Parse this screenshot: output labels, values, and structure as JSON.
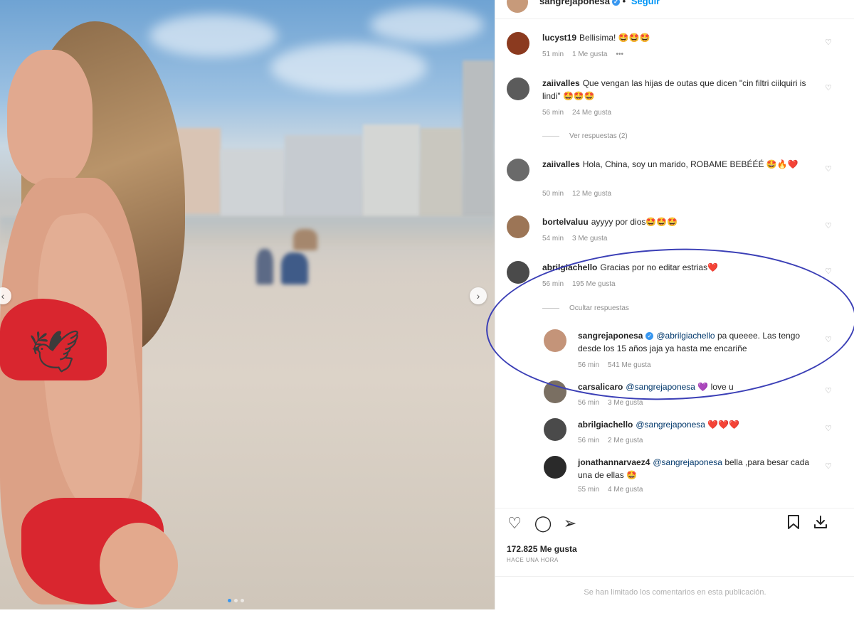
{
  "post": {
    "username": "sangrejaponesa",
    "follow": "Seguir",
    "more": "•••"
  },
  "icons": {
    "verified": "verified-badge-icon",
    "like": "heart-icon",
    "comment": "comment-icon",
    "share": "paper-plane-icon",
    "save": "bookmark-icon",
    "download": "download-icon"
  },
  "colors": {
    "accent": "#0095f6",
    "annotation": "#3b3fb6",
    "bikini": "#d9262f"
  },
  "comments": [
    {
      "user": "lucyst19",
      "text": "Bellisima! 🤩🤩🤩",
      "time": "51 min",
      "likes": "1 Me gusta",
      "extra": "•••"
    },
    {
      "user": "zaiivalles",
      "text": "Que vengan las hijas de outas que dicen \"cin filtri ciilquiri is lindi\" 🤩🤩🤩",
      "time": "56 min",
      "likes": "24 Me gusta",
      "replies": "Ver respuestas (2)"
    },
    {
      "user": "zaiivalles",
      "text": "Hola, China, soy un marido, ROBAME BEBÉÉÉ 🤩🔥❤️",
      "time": "50 min",
      "likes": "12 Me gusta"
    },
    {
      "user": "bortelvaluu",
      "text": "ayyyy por dios🤩🤩🤩",
      "time": "54 min",
      "likes": "3 Me gusta"
    },
    {
      "user": "abrilgiachello",
      "text": "Gracias por no editar estrias❤️",
      "time": "56 min",
      "likes": "195 Me gusta",
      "replies": "Ocultar respuestas"
    }
  ],
  "replies": [
    {
      "user": "sangrejaponesa",
      "mention": "@abrilgiachello",
      "text": "pa queeee. Las tengo desde los 15 años jaja ya hasta me encariñe",
      "time": "56 min",
      "likes": "541 Me gusta"
    },
    {
      "user": "carsalicaro",
      "mention": "@sangrejaponesa",
      "text": "💜 love u",
      "time": "56 min",
      "likes": "3 Me gusta"
    },
    {
      "user": "abrilgiachello",
      "mention": "@sangrejaponesa",
      "text": "❤️❤️❤️",
      "time": "56 min",
      "likes": "2 Me gusta"
    },
    {
      "user": "jonathannarvaez4",
      "mention": "@sangrejaponesa",
      "text": "bella ,para besar cada una de ellas 🤩",
      "time": "55 min",
      "likes": "4 Me gusta"
    }
  ],
  "footer": {
    "likes": "172.825 Me gusta",
    "time": "HACE UNA HORA",
    "limited": "Se han limitado los comentarios en esta publicación."
  }
}
